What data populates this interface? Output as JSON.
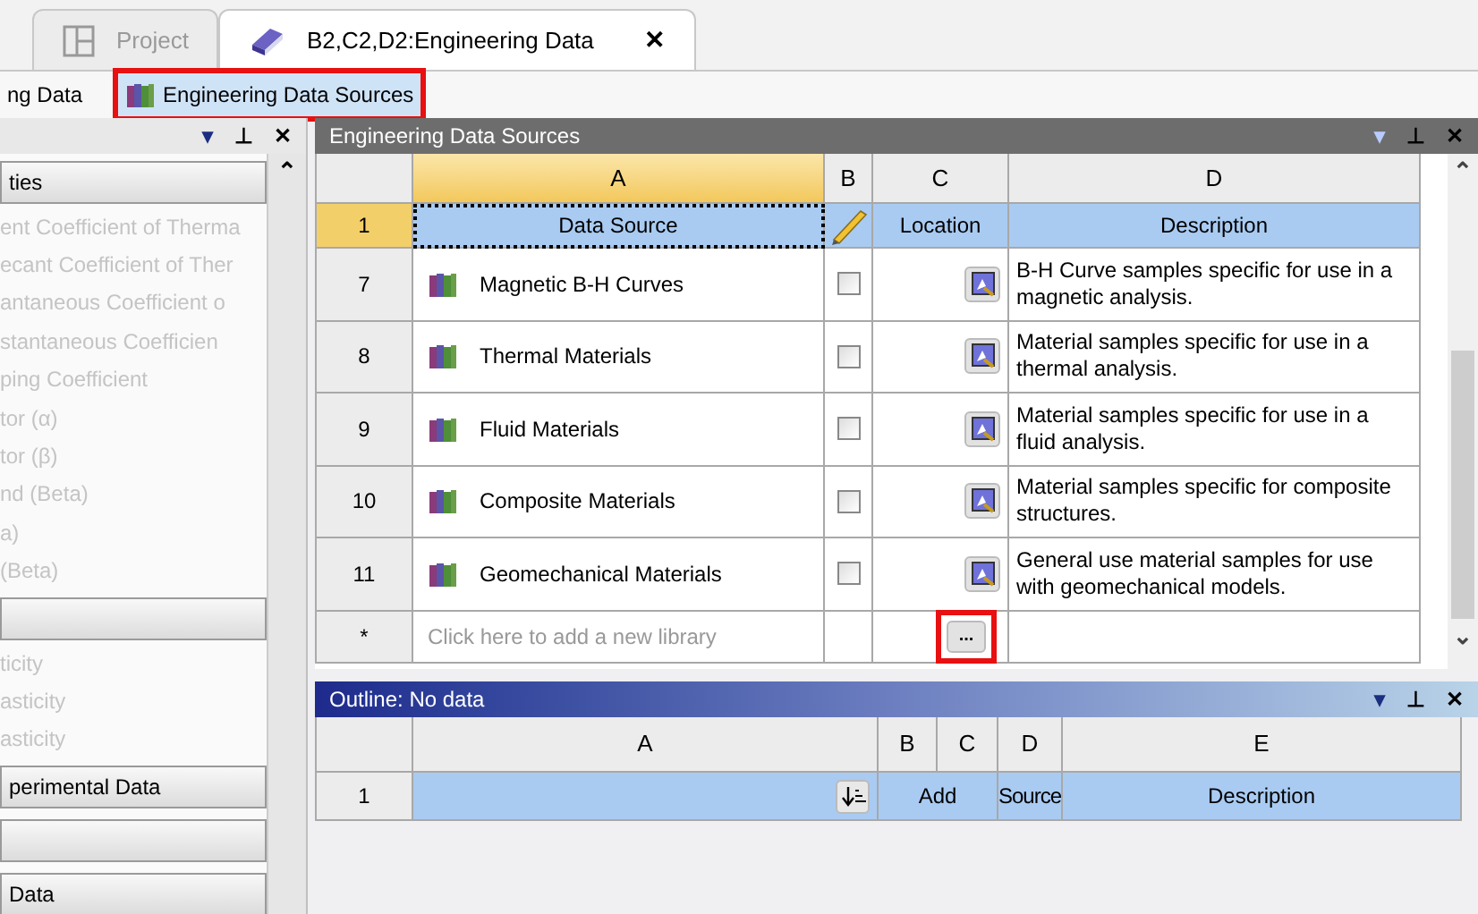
{
  "tabs": [
    {
      "label": "Project",
      "selected": false
    },
    {
      "label": "B2,C2,D2:Engineering Data",
      "selected": true,
      "close": "✕"
    }
  ],
  "toolbar": [
    {
      "label": "ng Data",
      "highlighted": false
    },
    {
      "label": "Engineering Data Sources",
      "highlighted": true
    }
  ],
  "left_panel": {
    "controls": [
      "▾",
      "⊥",
      "✕"
    ],
    "scroll_up": "⌃",
    "items": [
      {
        "kind": "group",
        "label": "ties"
      },
      {
        "kind": "item",
        "label": "ent Coefficient of Therma"
      },
      {
        "kind": "item",
        "label": "ecant Coefficient of Ther"
      },
      {
        "kind": "item",
        "label": "antaneous Coefficient o"
      },
      {
        "kind": "item",
        "label": "stantaneous Coefficien"
      },
      {
        "kind": "item",
        "label": "ping Coefficient"
      },
      {
        "kind": "item",
        "label": "tor (α)"
      },
      {
        "kind": "item",
        "label": "tor (β)"
      },
      {
        "kind": "item",
        "label": "nd (Beta)"
      },
      {
        "kind": "item",
        "label": "a)"
      },
      {
        "kind": "item",
        "label": "(Beta)"
      },
      {
        "kind": "group"
      },
      {
        "kind": "item",
        "label": "ticity"
      },
      {
        "kind": "item",
        "label": "asticity"
      },
      {
        "kind": "item",
        "label": "asticity"
      },
      {
        "kind": "group",
        "label": "perimental Data"
      },
      {
        "kind": "group"
      },
      {
        "kind": "group",
        "label": "Data"
      }
    ]
  },
  "sources_panel": {
    "title": "Engineering Data Sources",
    "controls": [
      "▾",
      "⊥",
      "✕"
    ],
    "scroll_up": "⌃",
    "scroll_down": "⌄",
    "columns": [
      "A",
      "B",
      "C",
      "D"
    ],
    "header_row": {
      "number": "1",
      "data_source": "Data Source",
      "location": "Location",
      "description": "Description"
    },
    "rows": [
      {
        "number": "7",
        "name": "Magnetic B-H Curves",
        "checked": false,
        "description": "B-H Curve samples specific for use in a magnetic analysis."
      },
      {
        "number": "8",
        "name": "Thermal Materials",
        "checked": false,
        "description": "Material samples specific for use in a thermal analysis."
      },
      {
        "number": "9",
        "name": "Fluid Materials",
        "checked": false,
        "description": "Material samples specific for use in a fluid analysis."
      },
      {
        "number": "10",
        "name": "Composite Materials",
        "checked": false,
        "description": "Material samples specific for composite structures."
      },
      {
        "number": "11",
        "name": "Geomechanical Materials",
        "checked": false,
        "description": "General use material samples for use with geomechanical models."
      }
    ],
    "new_row": {
      "number": "*",
      "placeholder": "Click here to add a new library",
      "browse": "...",
      "highlighted": true
    }
  },
  "outline_panel": {
    "title": "Outline: No data",
    "controls": [
      "▾",
      "⊥",
      "✕"
    ],
    "columns": [
      "A",
      "B",
      "C",
      "D",
      "E"
    ],
    "row": {
      "number": "1",
      "add": "Add",
      "source": "Source",
      "description": "Description"
    }
  }
}
